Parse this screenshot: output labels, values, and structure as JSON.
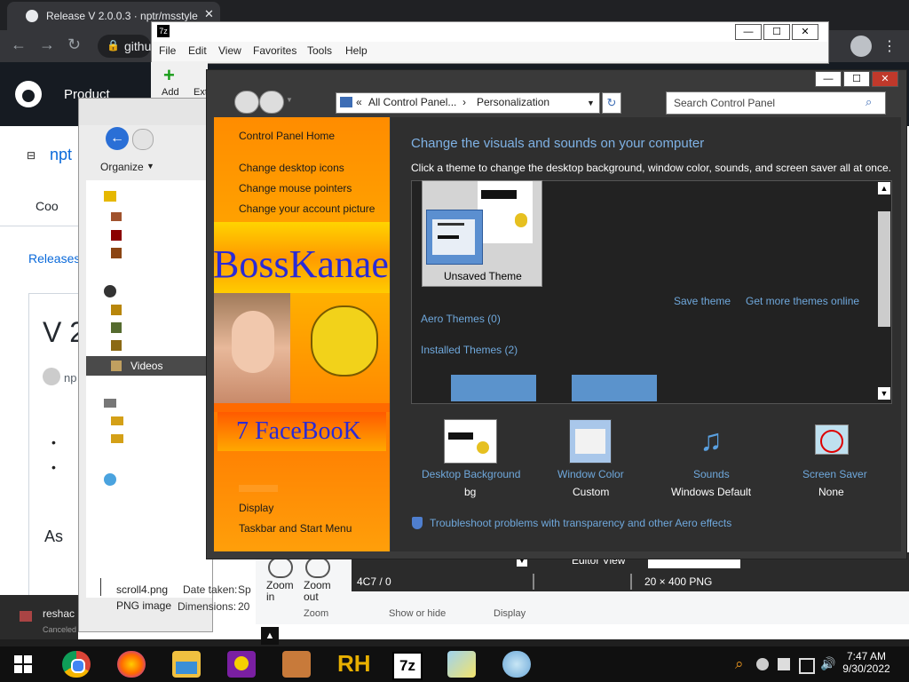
{
  "chrome": {
    "tab_title": "Release V 2.0.0.3 · nptr/msstyle",
    "address": "githu",
    "product_label": "Product",
    "repo_short": "npt",
    "code_tab": "Coo",
    "releases_link": "Releases",
    "release_heading": "V 2",
    "author_short": "np",
    "assets_heading": "As"
  },
  "zip": {
    "menu": [
      "File",
      "Edit",
      "View",
      "Favorites",
      "Tools",
      "Help"
    ],
    "toolbar_add": "Add",
    "toolbar_extract": "Ext"
  },
  "explorer": {
    "organize": "Organize",
    "nav_selected": "Videos",
    "file_name": "scroll4.png",
    "file_type": "PNG image",
    "date_taken_label": "Date taken:",
    "date_taken_value": "Sp",
    "dimensions_label": "Dimensions:",
    "dimensions_value": "20"
  },
  "notification": {
    "title": "reshac",
    "status": "Canceled"
  },
  "paint": {
    "zoom_in": "Zoom in",
    "zoom_out": "Zoom out",
    "group_zoom": "Zoom",
    "group_showhide": "Show or hide",
    "group_display": "Display",
    "editor_view": "Editor View",
    "status_id": "4C7 / 0",
    "status_dims": "20 × 400  PNG"
  },
  "control_panel": {
    "breadcrumb_root": "All Control Panel...",
    "breadcrumb_current": "Personalization",
    "search_placeholder": "Search Control Panel",
    "left_links": {
      "home": "Control Panel Home",
      "desktop_icons": "Change desktop icons",
      "mouse_pointers": "Change mouse pointers",
      "account_picture": "Change your account picture",
      "display": "Display",
      "taskbar": "Taskbar and Start Menu"
    },
    "banner_title": "BossKanae",
    "banner_sub": "7 FaceBooK",
    "heading": "Change the visuals and sounds on your computer",
    "subheading": "Click a theme to change the desktop background, window color, sounds, and screen saver all at once.",
    "unsaved_theme": "Unsaved Theme",
    "save_theme": "Save theme",
    "get_more": "Get more themes online",
    "aero_themes": "Aero Themes (0)",
    "installed_themes": "Installed Themes (2)",
    "settings": [
      {
        "label": "Desktop Background",
        "value": "bg"
      },
      {
        "label": "Window Color",
        "value": "Custom"
      },
      {
        "label": "Sounds",
        "value": "Windows Default"
      },
      {
        "label": "Screen Saver",
        "value": "None"
      }
    ],
    "troubleshoot": "Troubleshoot problems with transparency and other Aero effects"
  },
  "taskbar": {
    "time": "7:47 AM",
    "date": "9/30/2022",
    "rh_label": "RH",
    "sevenzip_label": "7z"
  }
}
